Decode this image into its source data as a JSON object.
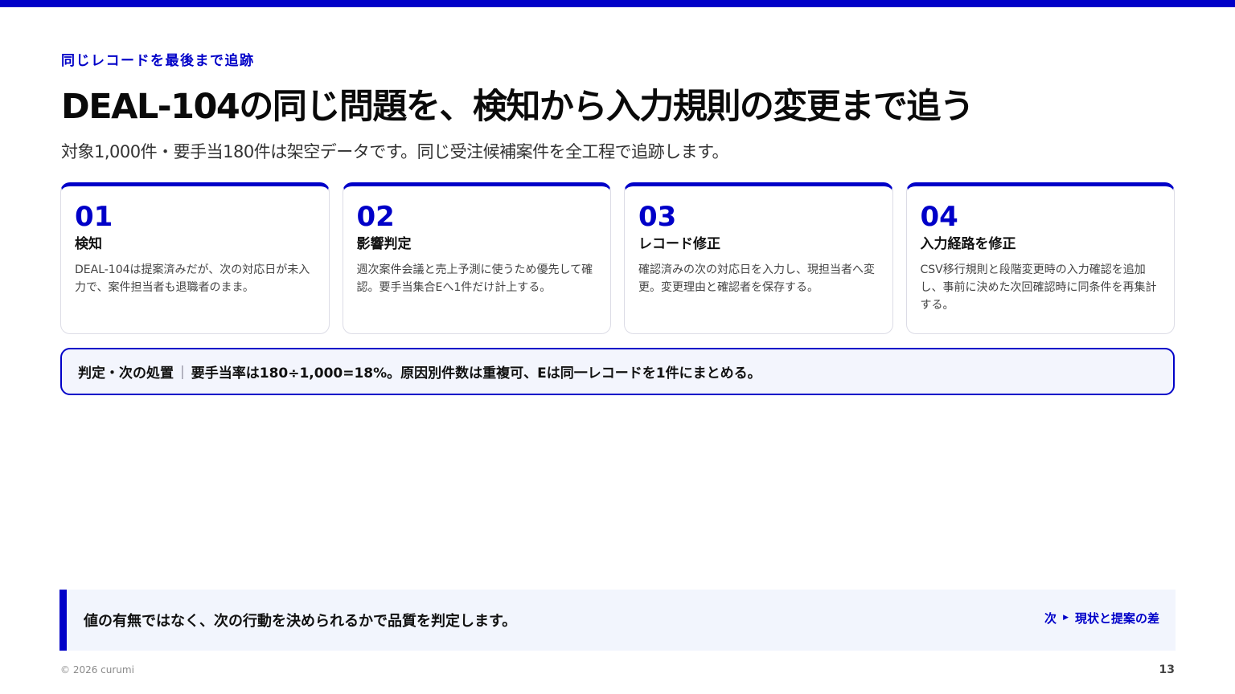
{
  "slide": {
    "eyebrow": "同じレコードを最後まで追跡",
    "title": "DEAL-104の同じ問題を、検知から入力規則の変更まで追う",
    "subtitle": "対象1,000件・要手当180件は架空データです。同じ受注候補案件を全工程で追跡します。"
  },
  "steps": [
    {
      "number": "01",
      "title": "検知",
      "description": "DEAL-104は提案済みだが、次の対応日が未入力で、案件担当者も退職者のまま。"
    },
    {
      "number": "02",
      "title": "影響判定",
      "description": "週次案件会議と売上予測に使うため優先して確認。要手当集合Eへ1件だけ計上する。"
    },
    {
      "number": "03",
      "title": "レコード修正",
      "description": "確認済みの次の対応日を入力し、現担当者へ変更。変更理由と確認者を保存する。"
    },
    {
      "number": "04",
      "title": "入力経路を修正",
      "description": "CSV移行規則と段階変更時の入力確認を追加し、事前に決めた次回確認時に同条件を再集計する。"
    }
  ],
  "callout": {
    "label": "判定・次の処置",
    "separator": "|",
    "text": "要手当率は180÷1,000=18%。原因別件数は重複可、Eは同一レコードを1件にまとめる。"
  },
  "footer": {
    "message": "値の有無ではなく、次の行動を決められるかで品質を判定します。",
    "next_prefix": "次",
    "next_arrow": "▶",
    "next_label": "現状と提案の差",
    "copyright": "© 2026 curumi",
    "page_number": "13"
  },
  "colors": {
    "accent": "#0000c8",
    "callout_bg": "#f3f5fd",
    "banner_bg": "#f2f5fd"
  }
}
